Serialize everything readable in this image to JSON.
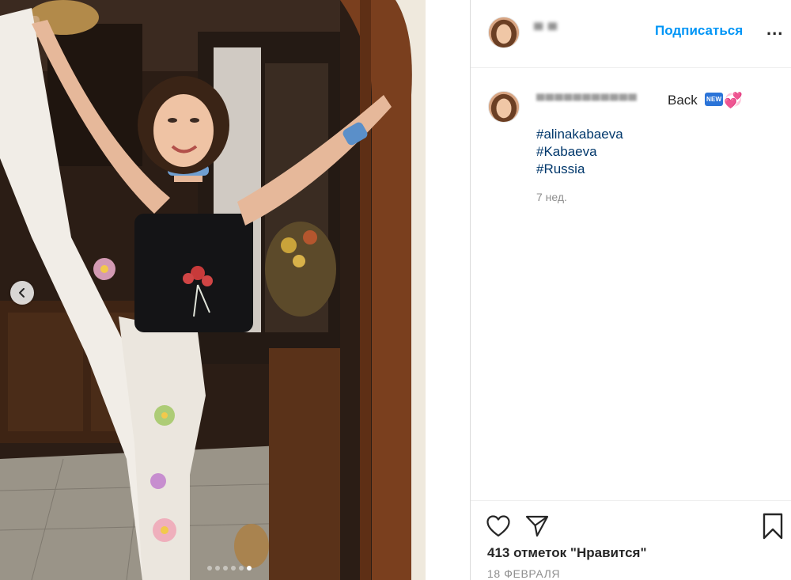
{
  "post": {
    "slide_count": 6,
    "active_slide": 6
  },
  "header": {
    "follow_label": "Подписаться",
    "more_label": "..."
  },
  "caption": {
    "text": "Back",
    "emoji_new": "NEW",
    "emoji_heart": "💞",
    "hashtags": [
      "#alinakabaeva",
      "#Kabaeva",
      "#Russia"
    ],
    "time_ago": "7 нед."
  },
  "footer": {
    "likes": "413 отметок \"Нравится\"",
    "date": "18 ФЕВРАЛЯ"
  },
  "icons": {
    "prev": "chevron-left-icon",
    "like": "heart-icon",
    "share": "paper-plane-icon",
    "save": "bookmark-icon"
  },
  "colors": {
    "link_blue": "#0095f6",
    "hashtag_blue": "#00376b",
    "muted_gray": "#8e8e8e",
    "text": "#262626"
  }
}
